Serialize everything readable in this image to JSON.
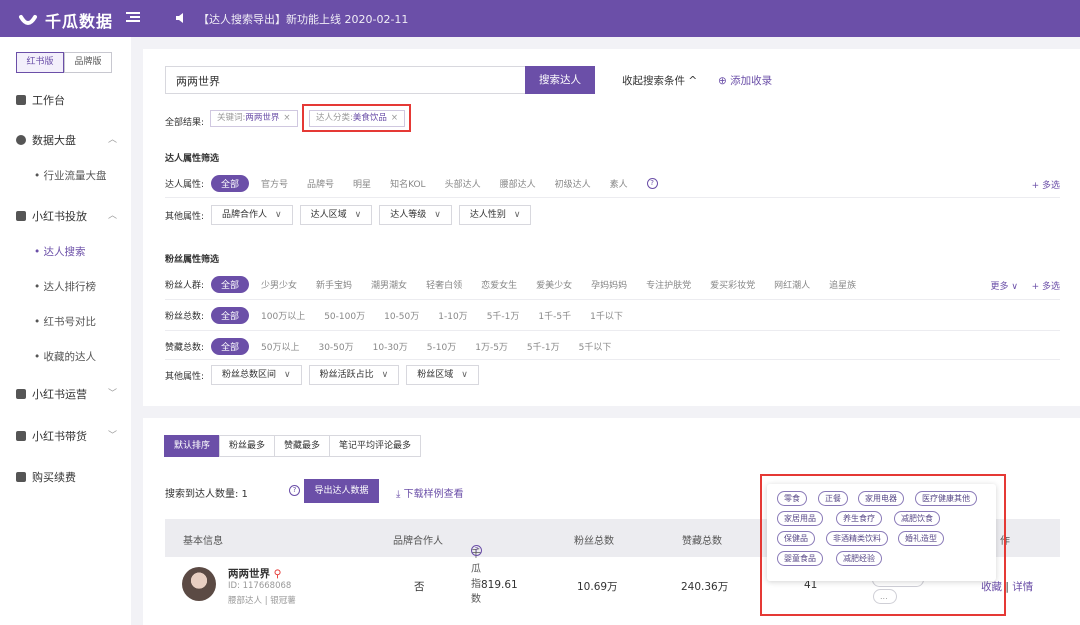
{
  "topbar": {
    "brand": "千瓜数据",
    "notice": "【达人搜索导出】新功能上线  2020-02-11"
  },
  "sidebar": {
    "editions": [
      "红书版",
      "品牌版"
    ],
    "workbench": "工作台",
    "groups": [
      {
        "label": "数据大盘",
        "items": [
          "• 行业流量大盘"
        ]
      },
      {
        "label": "小红书投放",
        "items": [
          "• 达人搜索",
          "• 达人排行榜",
          "• 红书号对比",
          "• 收藏的达人"
        ]
      },
      {
        "label": "小红书运营"
      },
      {
        "label": "小红书带货"
      },
      {
        "label": "购买续费"
      }
    ]
  },
  "search": {
    "value": "两两世界",
    "button": "搜索达人",
    "collapse": "收起搜索条件 ^",
    "add_fav": "⊕ 添加收录"
  },
  "results": {
    "label": "全部结果:",
    "tags": [
      {
        "key": "关键词:",
        "value": "两两世界"
      },
      {
        "key": "达人分类:",
        "value": "美食饮品"
      }
    ]
  },
  "kol_filter": {
    "title": "达人属性筛选",
    "attr_label": "达人属性:",
    "attr_options": [
      "全部",
      "官方号",
      "品牌号",
      "明星",
      "知名KOL",
      "头部达人",
      "腰部达人",
      "初级达人",
      "素人"
    ],
    "more": "+ 多选",
    "other_label": "其他属性:",
    "other_dropdowns": [
      "品牌合作人",
      "达人区域",
      "达人等级",
      "达人性别"
    ]
  },
  "fan_filter": {
    "title": "粉丝属性筛选",
    "crowd_label": "粉丝人群:",
    "crowd_options": [
      "全部",
      "少男少女",
      "新手宝妈",
      "潮男潮女",
      "轻奢白领",
      "恋爱女生",
      "爱美少女",
      "孕妈妈妈",
      "专注护肤党",
      "爱买彩妆党",
      "网红潮人",
      "追星族"
    ],
    "crowd_more": "更多 ∨",
    "crowd_multi": "+ 多选",
    "total_label": "粉丝总数:",
    "total_options": [
      "全部",
      "100万以上",
      "50-100万",
      "10-50万",
      "1-10万",
      "5千-1万",
      "1千-5千",
      "1千以下"
    ],
    "likes_label": "赞藏总数:",
    "likes_options": [
      "全部",
      "50万以上",
      "30-50万",
      "10-30万",
      "5-10万",
      "1万-5万",
      "5千-1万",
      "5千以下"
    ],
    "other_label": "其他属性:",
    "other_dropdowns": [
      "粉丝总数区间",
      "粉丝活跃占比",
      "粉丝区域"
    ]
  },
  "sort": {
    "tabs": [
      "默认排序",
      "粉丝最多",
      "赞藏最多",
      "笔记平均评论最多"
    ],
    "count_text": "搜索到达人数量:  1",
    "export": "导出达人数据",
    "download": "下载样例查看"
  },
  "table": {
    "headers": [
      "基本信息",
      "品牌合作人",
      "千瓜指数",
      "粉丝总数",
      "赞藏总数",
      "作"
    ],
    "row": {
      "name": "两两世界",
      "id": "ID:  117668068",
      "type": "腰部达人 | 银冠薯",
      "brand_partner": "否",
      "qiangua_index": "819.61",
      "fans": "10.69万",
      "likes": "240.36万",
      "col5": "41",
      "ops": [
        "收藏",
        "详情"
      ],
      "more": "..."
    }
  },
  "popup": {
    "tags": [
      "零食",
      "正餐",
      "家用电器",
      "医疗健康其他",
      "家居用品",
      "养生食疗",
      "减肥饮食",
      "保健品",
      "非酒精类饮料",
      "婚礼造型",
      "婴童食品",
      "减肥经验"
    ]
  },
  "colors": {
    "brand": "#6b4fa8",
    "highlight_box": "#e53935"
  }
}
